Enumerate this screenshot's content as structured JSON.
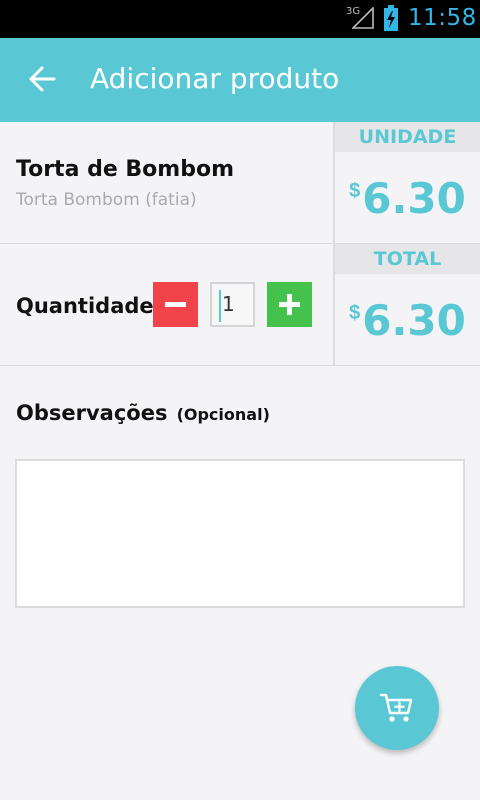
{
  "status_bar": {
    "network": "3G",
    "time": "11:58",
    "signal_icon": "signal-icon",
    "battery_icon": "battery-charging-icon"
  },
  "app_bar": {
    "title": "Adicionar produto",
    "back_icon": "arrow-back-icon"
  },
  "product": {
    "name": "Torta de Bombom",
    "description": "Torta Bombom (fatia)"
  },
  "unit_price": {
    "header": "UNIDADE",
    "currency": "$",
    "value": "6.30"
  },
  "quantity": {
    "label": "Quantidade",
    "value": "1",
    "decrement_icon": "minus-icon",
    "increment_icon": "plus-icon"
  },
  "total_price": {
    "header": "TOTAL",
    "currency": "$",
    "value": "6.30"
  },
  "observations": {
    "label": "Observações",
    "optional": "(Opcional)",
    "value": ""
  },
  "fab": {
    "icon": "add-to-cart-icon"
  },
  "colors": {
    "accent": "#5ac8d4",
    "minus": "#f0434a",
    "plus": "#44c24b"
  }
}
